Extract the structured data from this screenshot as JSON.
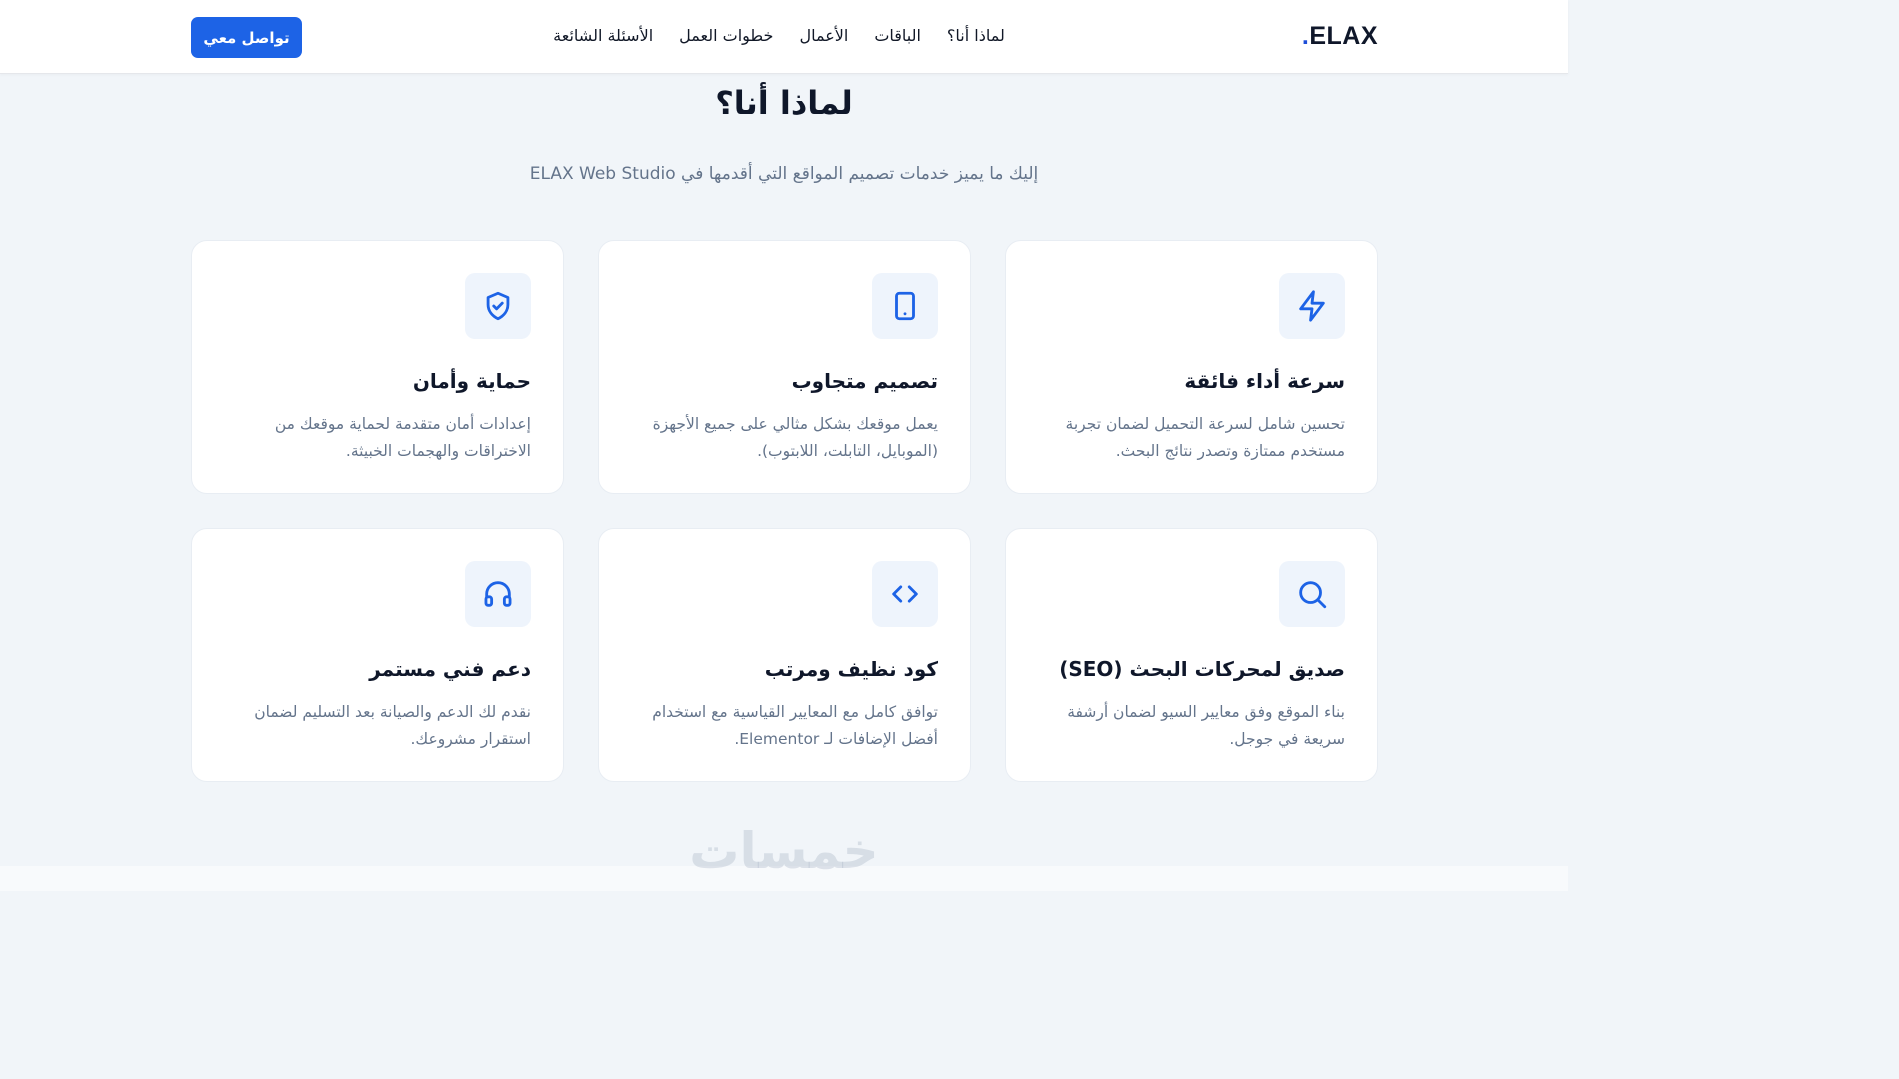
{
  "header": {
    "logo": "ELAX",
    "logo_dot": ".",
    "nav": [
      "لماذا أنا؟",
      "الباقات",
      "الأعمال",
      "خطوات العمل",
      "الأسئلة الشائعة"
    ],
    "cta_label": "تواصل معي"
  },
  "section": {
    "title": "لماذا أنا؟",
    "subtitle": "إليك ما يميز خدمات تصميم المواقع التي أقدمها في ELAX Web Studio"
  },
  "features": [
    {
      "icon": "zap-icon",
      "title": "سرعة أداء فائقة",
      "desc": "تحسين شامل لسرعة التحميل لضمان تجربة مستخدم ممتازة وتصدر نتائج البحث."
    },
    {
      "icon": "tablet-icon",
      "title": "تصميم متجاوب",
      "desc": "يعمل موقعك بشكل مثالي على جميع الأجهزة (الموبايل، التابلت، اللابتوب)."
    },
    {
      "icon": "shield-check-icon",
      "title": "حماية وأمان",
      "desc": "إعدادات أمان متقدمة لحماية موقعك من الاختراقات والهجمات الخبيثة."
    },
    {
      "icon": "search-icon",
      "title": "صديق لمحركات البحث (SEO)",
      "desc": "بناء الموقع وفق معايير السيو لضمان أرشفة سريعة في جوجل."
    },
    {
      "icon": "code-icon",
      "title": "كود نظيف ومرتب",
      "desc": "توافق كامل مع المعايير القياسية مع استخدام أفضل الإضافات لـ Elementor."
    },
    {
      "icon": "headphones-icon",
      "title": "دعم فني مستمر",
      "desc": "نقدم لك الدعم والصيانة بعد التسليم لضمان استقرار مشروعك."
    }
  ],
  "watermark": "خمسات",
  "colors": {
    "accent": "#1d63e6",
    "icon_bg": "#eef4fc",
    "page_bg": "#f1f5f9"
  }
}
